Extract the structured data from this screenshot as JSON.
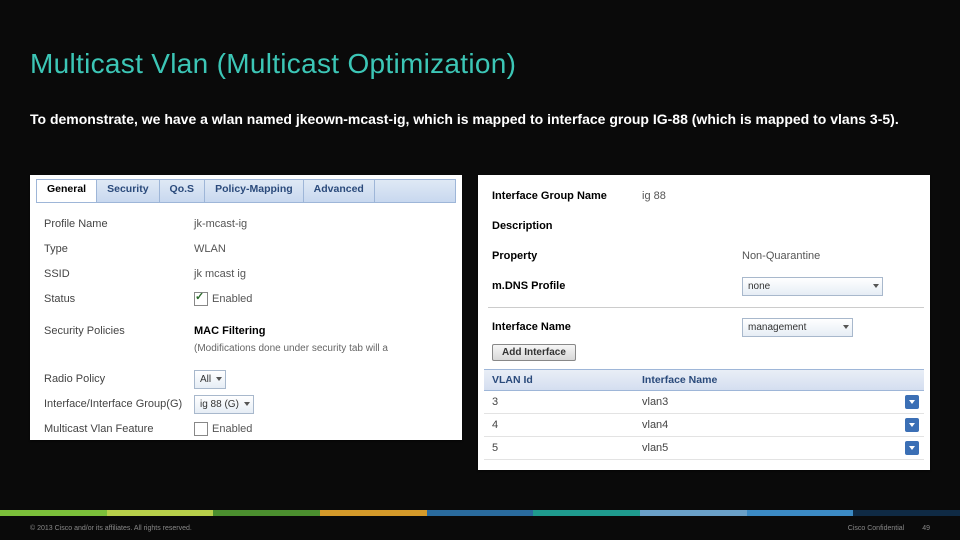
{
  "title": "Multicast Vlan (Multicast Optimization)",
  "body": "To demonstrate, we have a wlan named jkeown-mcast-ig, which is mapped to interface group IG-88 (which is mapped to vlans 3-5).",
  "left": {
    "tabs": [
      "General",
      "Security",
      "Qo.S",
      "Policy-Mapping",
      "Advanced"
    ],
    "profile_name_lbl": "Profile Name",
    "profile_name": "jk-mcast-ig",
    "type_lbl": "Type",
    "type": "WLAN",
    "ssid_lbl": "SSID",
    "ssid": "jk mcast ig",
    "status_lbl": "Status",
    "status_text": "Enabled",
    "sec_pol_lbl": "Security Policies",
    "mac_filter": "MAC Filtering",
    "note": "(Modifications done under security tab will a",
    "radio_lbl": "Radio Policy",
    "radio_val": "All",
    "ifg_lbl": "Interface/Interface Group(G)",
    "ifg_val": "ig 88 (G)",
    "mvlan_lbl": "Multicast Vlan Feature",
    "mvlan_text": "Enabled"
  },
  "right": {
    "ign_lbl": "Interface Group Name",
    "ign_val": "ig 88",
    "desc_lbl": "Description",
    "prop_lbl": "Property",
    "prop_val": "Non-Quarantine",
    "mdns_lbl": "m.DNS Profile",
    "mdns_val": "none",
    "ifn_lbl": "Interface Name",
    "ifn_val": "management",
    "add_btn": "Add Interface",
    "th1": "VLAN Id",
    "th2": "Interface Name",
    "rows": [
      {
        "id": "3",
        "name": "vlan3"
      },
      {
        "id": "4",
        "name": "vlan4"
      },
      {
        "id": "5",
        "name": "vlan5"
      }
    ]
  },
  "footer": {
    "left": "© 2013 Cisco and/or its affiliates. All rights reserved.",
    "right1": "Cisco Confidential",
    "right2": "49"
  },
  "bars": [
    "#7bbf3a",
    "#b7cf4a",
    "#4b8f2f",
    "#d49a2a",
    "#2a6b9e",
    "#1f9b8e",
    "#6aa0c8",
    "#3b8ac4",
    "#0f2a44"
  ]
}
